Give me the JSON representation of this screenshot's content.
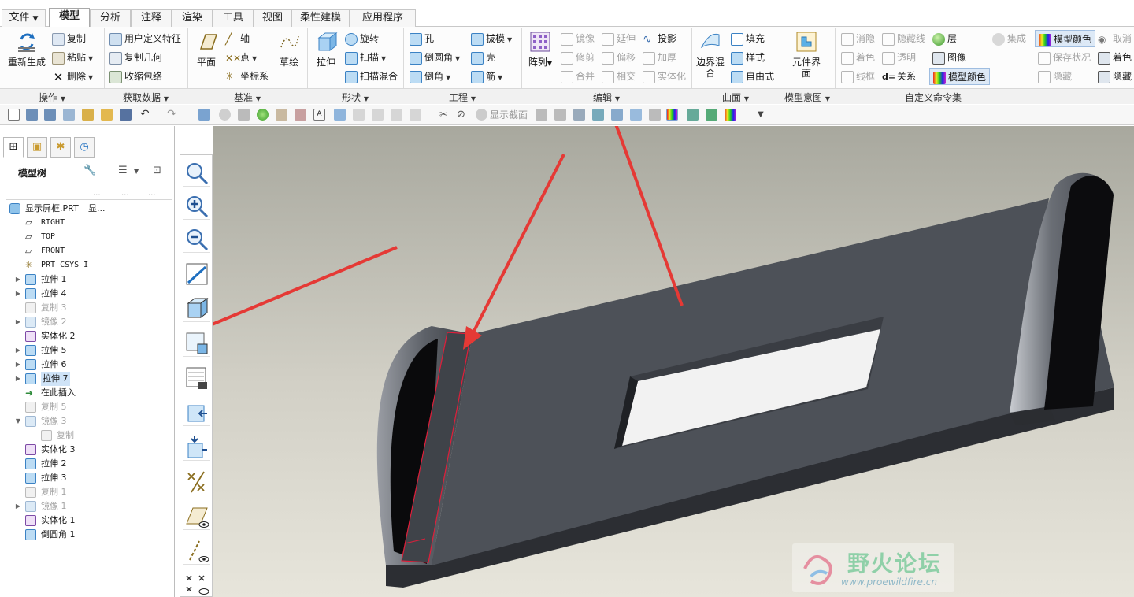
{
  "menu": {
    "file_label": "文件",
    "tabs": [
      "模型",
      "分析",
      "注释",
      "渲染",
      "工具",
      "视图",
      "柔性建模",
      "应用程序"
    ]
  },
  "ribbon": {
    "ops": {
      "regen": "重新生成",
      "copy": "复制",
      "paste": "粘贴",
      "delete": "删除"
    },
    "get_data": {
      "udf": "用户定义特征",
      "copy_geom": "复制几何",
      "shrinkwrap": "收缩包络"
    },
    "datum": {
      "plane": "平面",
      "axis": "轴",
      "point": "点",
      "csys": "坐标系",
      "sketch": "草绘"
    },
    "shapes": {
      "extrude": "拉伸",
      "revolve": "旋转",
      "sweep": "扫描",
      "swept_blend": "扫描混合"
    },
    "engineering": {
      "hole": "孔",
      "round": "倒圆角",
      "chamfer": "倒角",
      "draft": "拔模",
      "shell": "壳",
      "rib": "筋"
    },
    "editing": {
      "pattern": "阵列",
      "mirror": "镜像",
      "extend": "延伸",
      "project": "投影",
      "trim": "修剪",
      "offset": "偏移",
      "thicken": "加厚",
      "merge": "合并",
      "intersect": "相交",
      "solidify": "实体化"
    },
    "surfaces": {
      "boundary_blend": "边界混合",
      "fill": "填充",
      "style": "样式",
      "freestyle": "自由式"
    },
    "intent": {
      "component_interface": "元件界面"
    },
    "custom": {
      "hidden_line_removed": "消隐",
      "hidden_line": "隐藏线",
      "layer": "层",
      "integrate": "集成",
      "cancel": "取消",
      "shading": "着色",
      "transparent": "透明",
      "image": "图像",
      "save_state": "保存状况",
      "wireframe": "线框",
      "relations": "关系",
      "model_color": "模型颜色",
      "hide": "隐藏",
      "hide2": "隐藏"
    },
    "group_labels": [
      "操作",
      "获取数据",
      "基准",
      "形状",
      "工程",
      "编辑",
      "曲面",
      "模型意图",
      "自定义命令集"
    ]
  },
  "qat": {
    "show_section": "显示截面"
  },
  "left_pane": {
    "tree_title": "模型树",
    "col_headers": [
      "...",
      "...",
      "..."
    ],
    "root": {
      "name": "显示屏框.PRT",
      "extra": "显..."
    },
    "items": [
      {
        "label": "RIGHT",
        "type": "plane",
        "dim": false
      },
      {
        "label": "TOP",
        "type": "plane",
        "dim": false
      },
      {
        "label": "FRONT",
        "type": "plane",
        "dim": false
      },
      {
        "label": "PRT_CSYS_I",
        "type": "csys",
        "dim": false
      },
      {
        "label": "拉伸 1",
        "type": "extrude",
        "dim": false
      },
      {
        "label": "拉伸 4",
        "type": "extrude",
        "dim": false
      },
      {
        "label": "复制 3",
        "type": "copy",
        "dim": true
      },
      {
        "label": "镜像 2",
        "type": "mirror",
        "dim": true
      },
      {
        "label": "实体化 2",
        "type": "solidify",
        "dim": false
      },
      {
        "label": "拉伸 5",
        "type": "extrude",
        "dim": false
      },
      {
        "label": "拉伸 6",
        "type": "extrude",
        "dim": false
      },
      {
        "label": "拉伸 7",
        "type": "extrude",
        "dim": false
      },
      {
        "label": "在此插入",
        "type": "insert",
        "dim": false
      },
      {
        "label": "复制 5",
        "type": "copy",
        "dim": true
      },
      {
        "label": "镜像 3",
        "type": "mirror",
        "dim": true
      },
      {
        "label": "复制",
        "type": "copy",
        "dim": true
      },
      {
        "label": "实体化 3",
        "type": "solidify",
        "dim": false
      },
      {
        "label": "拉伸 2",
        "type": "extrude",
        "dim": false
      },
      {
        "label": "拉伸 3",
        "type": "extrude",
        "dim": false
      },
      {
        "label": "复制 1",
        "type": "copy",
        "dim": true
      },
      {
        "label": "镜像 1",
        "type": "mirror",
        "dim": true
      },
      {
        "label": "实体化 1",
        "type": "solidify",
        "dim": false
      },
      {
        "label": "倒圆角 1",
        "type": "round",
        "dim": false
      }
    ]
  },
  "watermark": {
    "title": "野火论坛",
    "url": "www.proewildfire.cn"
  },
  "colors": {
    "accent_red": "#e53935",
    "selection_blue": "#cfe3f7",
    "model_dark": "#4a4e54"
  }
}
